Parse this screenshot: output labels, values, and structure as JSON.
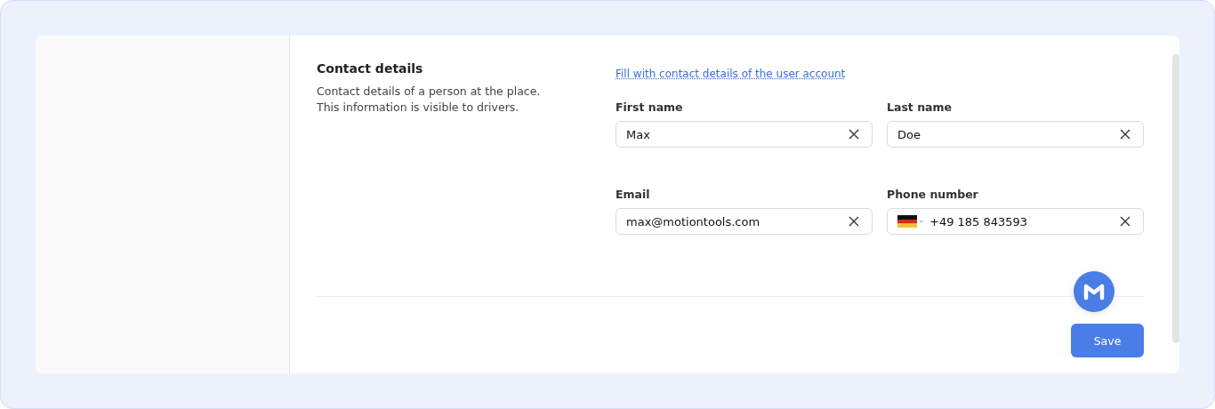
{
  "section": {
    "title": "Contact details",
    "description": "Contact details of a person at the place. This information is visible to drivers."
  },
  "fill_link": "Fill with contact details of the user account",
  "fields": [
    {
      "kind": "text",
      "label": "First name",
      "value": "Max"
    },
    {
      "kind": "text",
      "label": "Last name",
      "value": "Doe"
    },
    {
      "kind": "text",
      "label": "Email",
      "value": "max@motiontools.com"
    },
    {
      "kind": "phone",
      "label": "Phone number",
      "value": "+49 185 843593"
    }
  ],
  "buttons": {
    "save": "Save"
  }
}
